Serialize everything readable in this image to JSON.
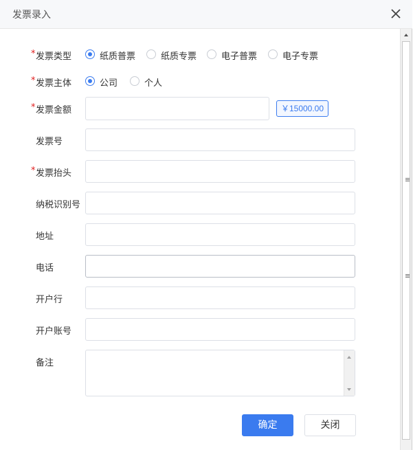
{
  "dialog": {
    "title": "发票录入",
    "close_icon": "close-icon"
  },
  "form": {
    "invoice_type": {
      "label": "发票类型",
      "required": "*",
      "options": [
        "纸质普票",
        "纸质专票",
        "电子普票",
        "电子专票"
      ],
      "selected": "纸质普票"
    },
    "invoice_subject": {
      "label": "发票主体",
      "required": "*",
      "options": [
        "公司",
        "个人"
      ],
      "selected": "公司"
    },
    "invoice_amount": {
      "label": "发票金额",
      "required": "*",
      "value": "",
      "badge": "￥15000.00"
    },
    "invoice_number": {
      "label": "发票号",
      "value": ""
    },
    "invoice_header": {
      "label": "发票抬头",
      "required": "*",
      "value": ""
    },
    "tax_id": {
      "label": "纳税识别号",
      "value": ""
    },
    "address": {
      "label": "地址",
      "value": ""
    },
    "phone": {
      "label": "电话",
      "value": ""
    },
    "bank": {
      "label": "开户行",
      "value": ""
    },
    "bank_account": {
      "label": "开户账号",
      "value": ""
    },
    "remark": {
      "label": "备注",
      "value": ""
    }
  },
  "actions": {
    "confirm_label": "确定",
    "close_label": "关闭"
  },
  "colors": {
    "accent": "#3a7bef",
    "required": "#e02020"
  }
}
